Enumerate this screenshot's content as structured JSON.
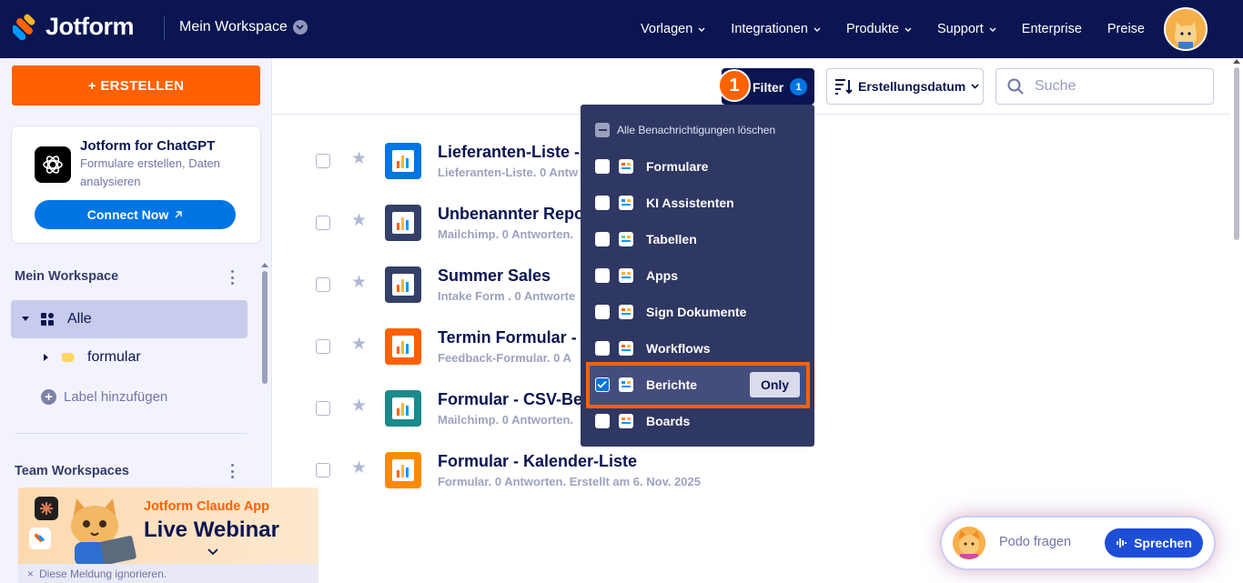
{
  "topnav": {
    "brand": "Jotform",
    "workspace": "Mein Workspace",
    "links": [
      "Vorlagen",
      "Integrationen",
      "Produkte",
      "Support",
      "Enterprise",
      "Preise"
    ]
  },
  "sidebar": {
    "create_label": "+ ERSTELLEN",
    "gpt_card": {
      "title": "Jotform for ChatGPT",
      "subtitle": "Formulare erstellen, Daten analysieren",
      "button": "Connect Now"
    },
    "my_workspace_title": "Mein Workspace",
    "all_label": "Alle",
    "folder_label": "formular",
    "add_label": "Label hinzufügen",
    "team_title": "Team Workspaces"
  },
  "webinar": {
    "subtitle": "Jotform Claude App",
    "title": "Live Webinar",
    "dismiss": "Diese Meldung ignorieren."
  },
  "toolbar": {
    "filter_label": "Filter",
    "filter_count": "1",
    "step_badge": "1",
    "sort_label": "Erstellungsdatum",
    "search_placeholder": "Suche"
  },
  "forms": [
    {
      "title": "Lieferanten-Liste -",
      "subtitle": "Lieferanten-Liste. 0 Antw",
      "icon_color": "#0075e3"
    },
    {
      "title": "Unbenannter Repor",
      "subtitle": "Mailchimp. 0 Antworten.",
      "icon_color": "#344067"
    },
    {
      "title": "Summer Sales",
      "subtitle": "Intake Form . 0 Antworte",
      "icon_color": "#344067"
    },
    {
      "title": "Termin Formular - F",
      "subtitle": "Feedback-Formular. 0 A",
      "icon_color": "#ff6100"
    },
    {
      "title": "Formular - CSV-Ber",
      "subtitle": "Mailchimp. 0 Antworten.",
      "icon_color": "#1a8a8a"
    },
    {
      "title": "Formular - Kalender-Liste",
      "subtitle": "Formular. 0 Antworten. Erstellt am 6. Nov. 2025",
      "icon_color": "#ff8a00"
    }
  ],
  "filter_dropdown": {
    "clear_label": "Alle Benachrichtigungen löschen",
    "items": [
      {
        "label": "Formulare",
        "checked": false
      },
      {
        "label": "KI Assistenten",
        "checked": false
      },
      {
        "label": "Tabellen",
        "checked": false
      },
      {
        "label": "Apps",
        "checked": false
      },
      {
        "label": "Sign Dokumente",
        "checked": false
      },
      {
        "label": "Workflows",
        "checked": false
      },
      {
        "label": "Berichte",
        "checked": true
      },
      {
        "label": "Boards",
        "checked": false
      }
    ],
    "only_label": "Only"
  },
  "podo": {
    "placeholder": "Podo fragen",
    "speak_label": "Sprechen"
  }
}
